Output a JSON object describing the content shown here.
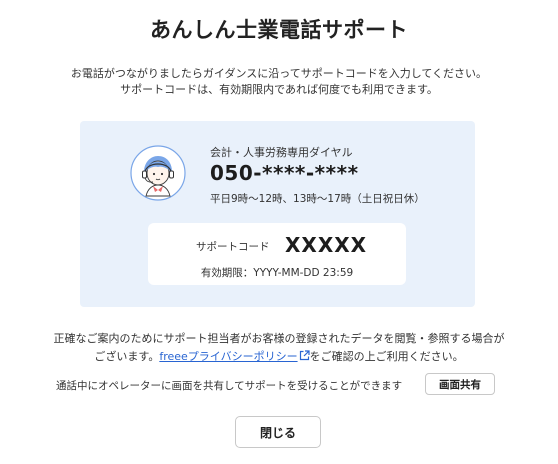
{
  "dialog": {
    "title": "あんしん士業電話サポート",
    "instruction_line1": "お電話がつながりましたらガイダンスに沿ってサポートコードを入力してください。",
    "instruction_line2": "サポートコードは、有効期限内であれば何度でも利用できます。"
  },
  "support": {
    "line_name": "会計・人事労務専用ダイヤル",
    "phone_number": "050-****-****",
    "hours": "平日9時〜12時、13時〜17時（土日祝日休）",
    "avatar_icon": "operator-headset-icon",
    "code_label": "サポートコード",
    "code_value": "XXXXX",
    "expiry": "有効期限：YYYY-MM-DD 23:59"
  },
  "privacy": {
    "line1": "正確なご案内のためにサポート担当者がお客様の登録されたデータを閲覧・参照する場合が",
    "prefix": "ございます。",
    "link_text": "freeeプライバシーポリシー",
    "link_icon": "external-link-icon",
    "suffix": "をご確認の上ご利用ください。"
  },
  "screen_share": {
    "text": "通話中にオペレーターに画面を共有してサポートを受けることができます",
    "button_label": "画面共有"
  },
  "footer": {
    "close_label": "閉じる"
  },
  "colors": {
    "panel_bg": "#e9f1fb",
    "link": "#2864d2",
    "avatar_accent": "#e66a6a",
    "avatar_hair": "#7aa6e8"
  }
}
